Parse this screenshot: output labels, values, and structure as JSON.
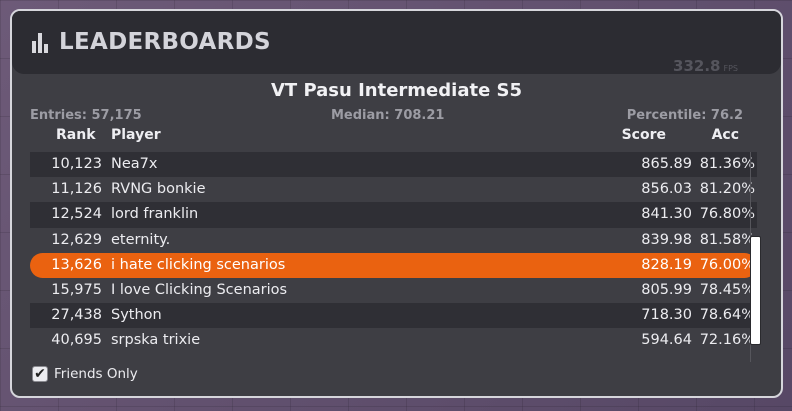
{
  "panel": {
    "title": "LEADERBOARDS",
    "icon": "bar-chart-icon",
    "fps_value": "332.8",
    "fps_unit": "FPS"
  },
  "scenario": {
    "name": "VT Pasu Intermediate S5",
    "entries_text": "Entries: 57,175",
    "median_text": "Median: 708.21",
    "percentile_text": "Percentile: 76.2"
  },
  "columns": {
    "rank": "Rank",
    "player": "Player",
    "score": "Score",
    "acc": "Acc"
  },
  "rows": [
    {
      "rank": "10,123",
      "player": "Nea7x",
      "score": "865.89",
      "acc": "81.36%"
    },
    {
      "rank": "11,126",
      "player": "RVNG bonkie",
      "score": "856.03",
      "acc": "81.20%"
    },
    {
      "rank": "12,524",
      "player": "lord franklin",
      "score": "841.30",
      "acc": "76.80%"
    },
    {
      "rank": "12,629",
      "player": "eternity.",
      "score": "839.98",
      "acc": "81.58%"
    },
    {
      "rank": "13,626",
      "player": "i hate clicking scenarios",
      "score": "828.19",
      "acc": "76.00%",
      "highlighted": true
    },
    {
      "rank": "15,975",
      "player": "I love Clicking Scenarios",
      "score": "805.99",
      "acc": "78.45%"
    },
    {
      "rank": "27,438",
      "player": "Sython",
      "score": "718.30",
      "acc": "78.64%"
    },
    {
      "rank": "40,695",
      "player": "srpska trixie",
      "score": "594.64",
      "acc": "72.16%"
    }
  ],
  "friends_only": {
    "label": "Friends Only",
    "checked": true,
    "check_glyph": "✔"
  },
  "colors": {
    "highlight": "#ea6210",
    "panel_bg": "#3e3e44",
    "header_bg": "#2c2c32"
  }
}
